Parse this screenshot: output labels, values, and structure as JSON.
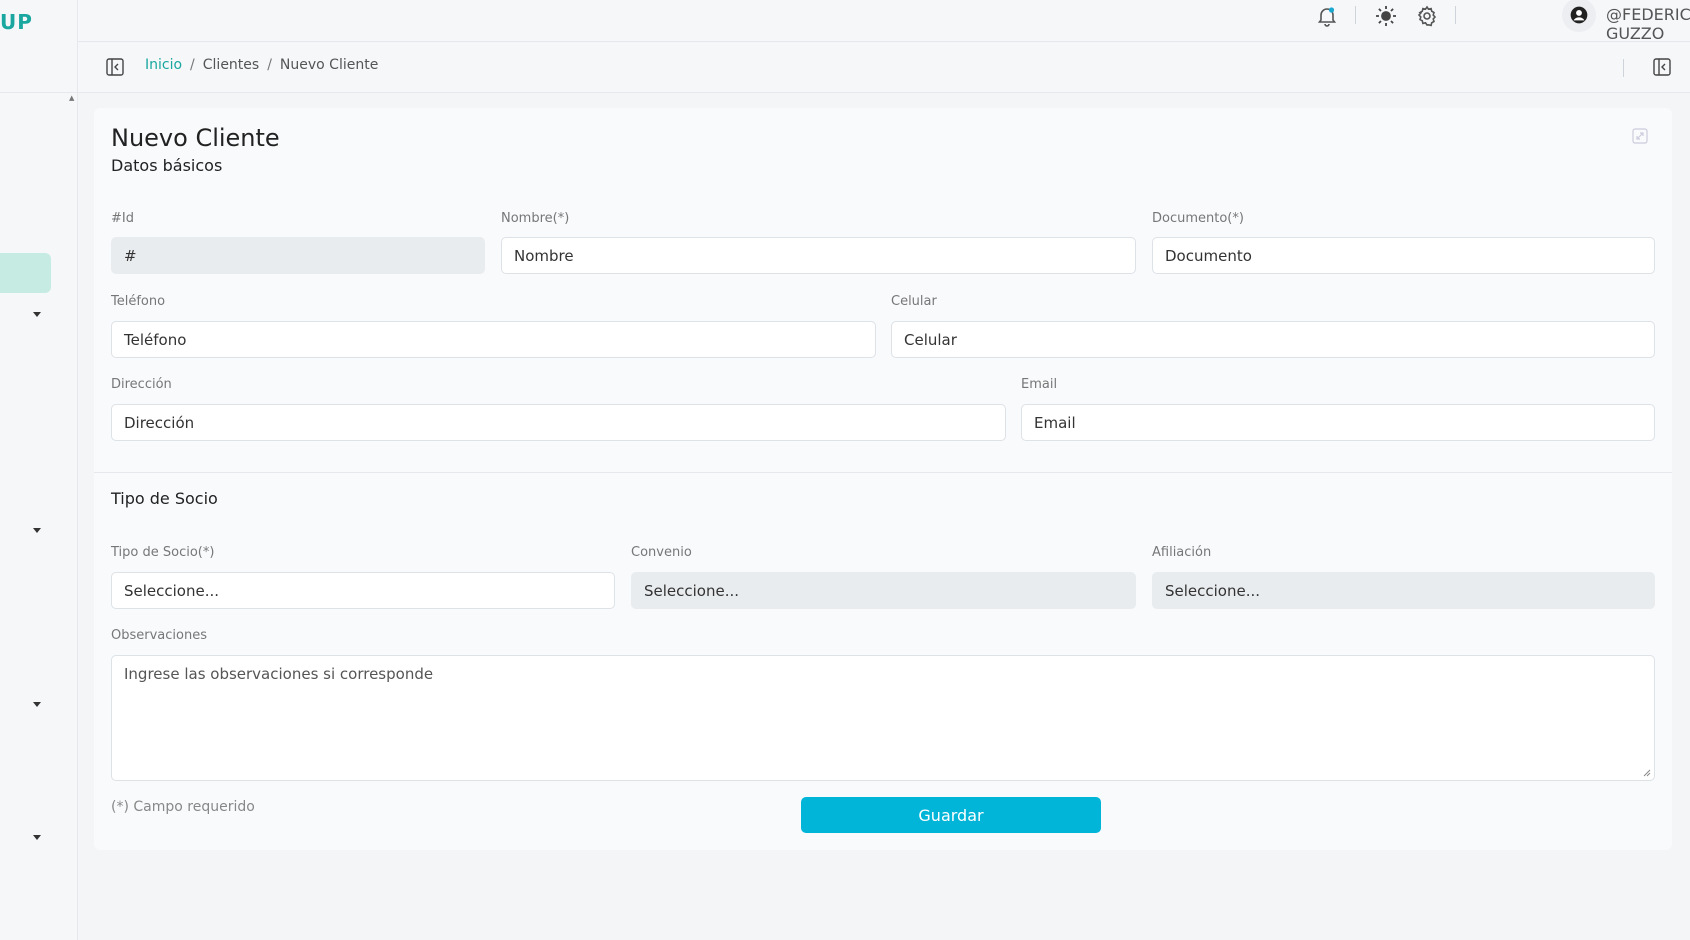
{
  "app": {
    "logo_text": "UP"
  },
  "header": {
    "username": "@FEDERICO GUZZO"
  },
  "icons": {
    "notifications": "bell-icon",
    "theme": "sun-icon",
    "settings": "gear-icon",
    "user": "user-circle-icon",
    "sidebar_toggle": "panel-left-icon",
    "panel_toggle": "panel-right-icon",
    "expand": "expand-icon"
  },
  "breadcrumb": {
    "home": "Inicio",
    "separator": "/",
    "section": "Clientes",
    "current": "Nuevo Cliente"
  },
  "form": {
    "title": "Nuevo Cliente",
    "subtitle": "Datos básicos",
    "id": {
      "label": "#Id",
      "placeholder": "#"
    },
    "nombre": {
      "label": "Nombre(*)",
      "placeholder": "Nombre"
    },
    "documento": {
      "label": "Documento(*)",
      "placeholder": "Documento"
    },
    "telefono": {
      "label": "Teléfono",
      "placeholder": "Teléfono"
    },
    "celular": {
      "label": "Celular",
      "placeholder": "Celular"
    },
    "direccion": {
      "label": "Dirección",
      "placeholder": "Dirección"
    },
    "email": {
      "label": "Email",
      "placeholder": "Email"
    },
    "section_title": "Tipo de Socio",
    "tipo_socio": {
      "label": "Tipo de Socio(*)",
      "value": "Seleccione..."
    },
    "convenio": {
      "label": "Convenio",
      "value": "Seleccione..."
    },
    "afiliacion": {
      "label": "Afiliación",
      "value": "Seleccione..."
    },
    "observaciones": {
      "label": "Observaciones",
      "placeholder": "Ingrese las observaciones si corresponde"
    },
    "required_note": "(*) Campo requerido",
    "save_label": "Guardar"
  },
  "colors": {
    "accent": "#1aa7a0",
    "button": "#00b5d8",
    "sidebar_active": "#c5ebe3"
  }
}
